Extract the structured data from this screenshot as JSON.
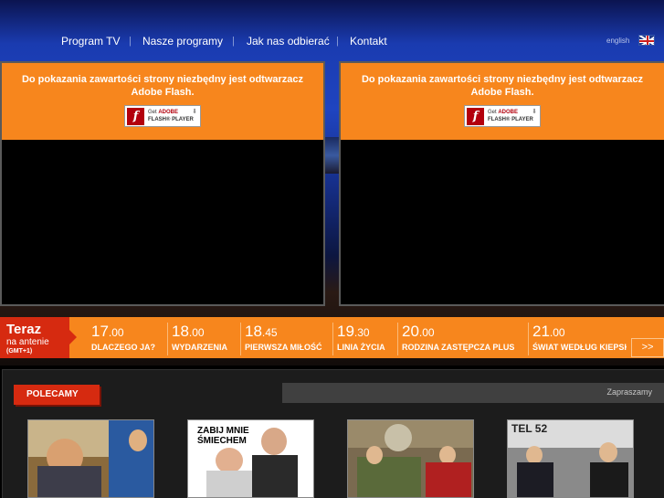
{
  "nav": {
    "items": [
      "Program TV",
      "Nasze programy",
      "Jak nas odbierać",
      "Kontakt"
    ],
    "separator": "|",
    "lang": "english",
    "flag_icon": "uk-flag-icon"
  },
  "flash_panels": [
    {
      "message": "Do pokazania zawartości strony niezbędny jest odtwarzacz Adobe Flash.",
      "button_line1_prefix": "Get",
      "button_line1_brand": "ADOBE",
      "button_line2": "FLASH® PLAYER",
      "button_logo": "f"
    },
    {
      "message": "Do pokazania zawartości strony niezbędny jest odtwarzacz Adobe Flash.",
      "button_line1_prefix": "Get",
      "button_line1_brand": "ADOBE",
      "button_line2": "FLASH® PLAYER",
      "button_logo": "f"
    }
  ],
  "schedule": {
    "teraz": "Teraz",
    "na_antenie": "na antenie",
    "timezone": "(GMT+1)",
    "slots": [
      {
        "hour": "17",
        "min": ".00",
        "title": "DLACZEGO JA?"
      },
      {
        "hour": "18",
        "min": ".00",
        "title": "WYDARZENIA"
      },
      {
        "hour": "18",
        "min": ".45",
        "title": "PIERWSZA MIŁOŚĆ"
      },
      {
        "hour": "19",
        "min": ".30",
        "title": "LINIA ŻYCIA"
      },
      {
        "hour": "20",
        "min": ".00",
        "title": "RODZINA ZASTĘPCZA PLUS"
      },
      {
        "hour": "21",
        "min": ".00",
        "title": "ŚWIAT WEDŁUG KIEPSKICH"
      }
    ],
    "next_label": ">>"
  },
  "recommend": {
    "polecamy": "POLECAMY",
    "zapraszamy": "Zapraszamy",
    "thumbs": [
      {
        "caption": ""
      },
      {
        "caption": "ZABIJ MNIE ŚMIECHEM"
      },
      {
        "caption": ""
      },
      {
        "caption": "TEL 52"
      }
    ]
  },
  "colors": {
    "accent_orange": "#f7861d",
    "accent_red": "#d62a10",
    "header_blue": "#1f44c0"
  }
}
